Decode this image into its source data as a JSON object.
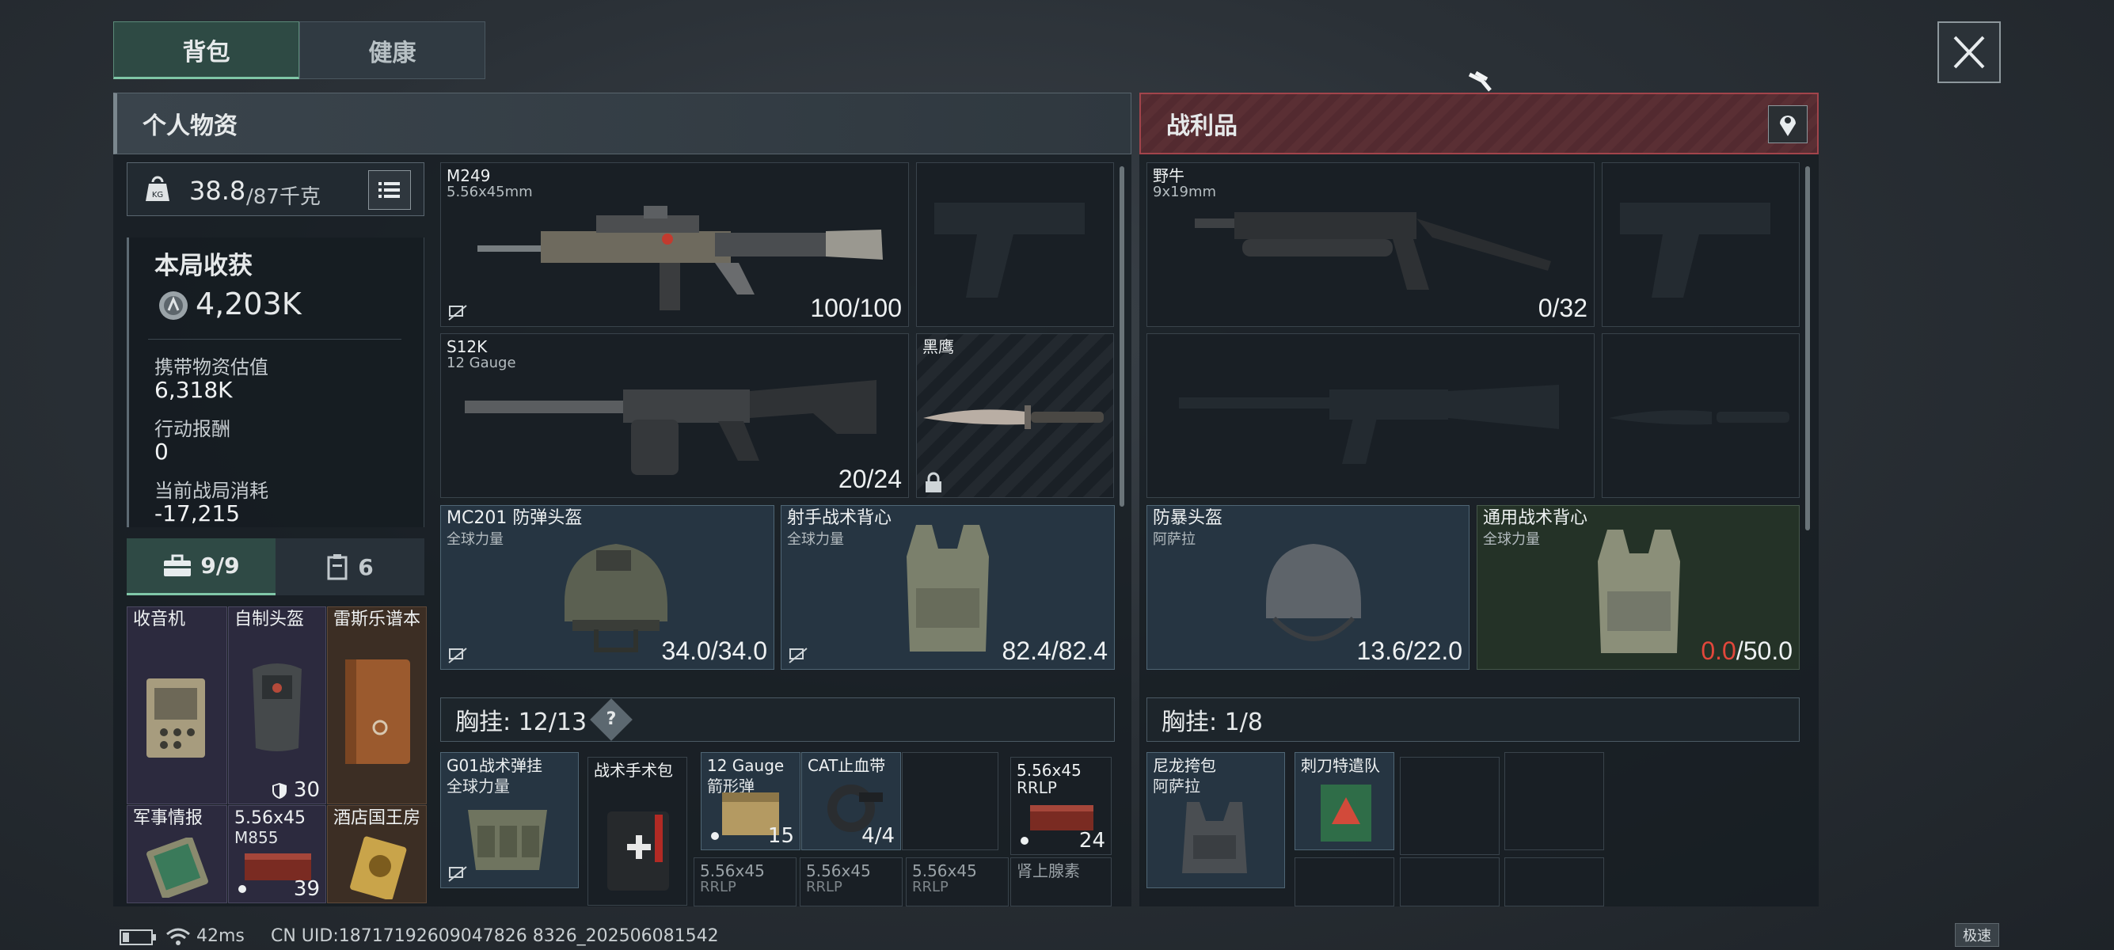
{
  "tabs": [
    {
      "label": "背包"
    },
    {
      "label": "健康"
    }
  ],
  "personal": {
    "title": "个人物资",
    "weight": "38.8",
    "weight_max": "/87千克",
    "session_title": "本局收获",
    "session_value": "4,203K",
    "stats": [
      {
        "label": "携带物资估值",
        "value": "6,318K"
      },
      {
        "label": "行动报酬",
        "value": "0"
      },
      {
        "label": "当前战局消耗",
        "value": "-17,215"
      }
    ],
    "slots_count": "9/9",
    "case_count": "6"
  },
  "loot": {
    "title": "战利品"
  },
  "left_items": {
    "m249": {
      "name": "M249",
      "sub": "5.56x45mm",
      "count": "100/100"
    },
    "s12k": {
      "name": "S12K",
      "sub": "12 Gauge",
      "count": "20/24"
    },
    "knife": {
      "name": "黑鹰"
    },
    "helmet": {
      "name": "MC201 防弹头盔",
      "sub": "全球力量",
      "count": "34.0/34.0"
    },
    "vest": {
      "name": "射手战术背心",
      "sub": "全球力量",
      "count": "82.4/82.4"
    }
  },
  "right_items": {
    "bison": {
      "name": "野牛",
      "sub": "9x19mm",
      "count": "0/32"
    },
    "helmet": {
      "name": "防暴头盔",
      "sub": "阿萨拉",
      "count": "13.6/22.0"
    },
    "vest": {
      "name": "通用战术背心",
      "sub": "全球力量",
      "count_red": "0.0",
      "count_rest": "/50.0"
    }
  },
  "rig_left": {
    "label": "胸挂: 12/13",
    "help": "?"
  },
  "rig_right": {
    "label": "胸挂: 1/8"
  },
  "backpack_items": [
    {
      "name": "收音机"
    },
    {
      "name": "自制头盔",
      "count": "30"
    },
    {
      "name": "雷斯乐谱本"
    },
    {
      "name": "军事情报"
    },
    {
      "name": "5.56x45",
      "sub": "M855",
      "count": "39"
    },
    {
      "name": "酒店国王房"
    }
  ],
  "rig_items": [
    {
      "name": "G01战术弹挂",
      "sub": "全球力量"
    },
    {
      "name": "战术手术包"
    },
    {
      "name": "12 Gauge",
      "sub": "箭形弹",
      "count": "15"
    },
    {
      "name": "CAT止血带",
      "count": "4/4"
    },
    {
      "name": "5.56x45",
      "sub": "RRLP",
      "count": "24"
    },
    {
      "name": "5.56x45",
      "sub": "RRLP"
    },
    {
      "name": "5.56x45",
      "sub": "RRLP"
    },
    {
      "name": "5.56x45",
      "sub": "RRLP"
    },
    {
      "name": "肾上腺素"
    }
  ],
  "rig_right_items": [
    {
      "name": "尼龙挎包",
      "sub": "阿萨拉"
    },
    {
      "name": "刺刀特遣队"
    }
  ],
  "status": {
    "ping": "42ms",
    "uid": "CN UID:18717192609047826 8326_202506081542",
    "speed": "极速"
  }
}
